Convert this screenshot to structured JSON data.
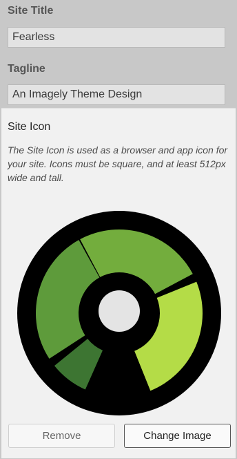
{
  "site_title": {
    "label": "Site Title",
    "value": "Fearless"
  },
  "tagline": {
    "label": "Tagline",
    "value": "An Imagely Theme Design"
  },
  "site_icon": {
    "title": "Site Icon",
    "description": "The Site Icon is used as a browser and app icon for your site. Icons must be square, and at least 512px wide and tall.",
    "image_name": "fearless-ring-logo",
    "colors": {
      "background": "#000000",
      "segment_dark": "#3d7532",
      "segment_mid": "#5e9b3b",
      "segment_green": "#73ad3d",
      "segment_lime": "#b4dc47",
      "center": "#e4e4e4"
    },
    "remove_label": "Remove",
    "change_label": "Change Image"
  }
}
